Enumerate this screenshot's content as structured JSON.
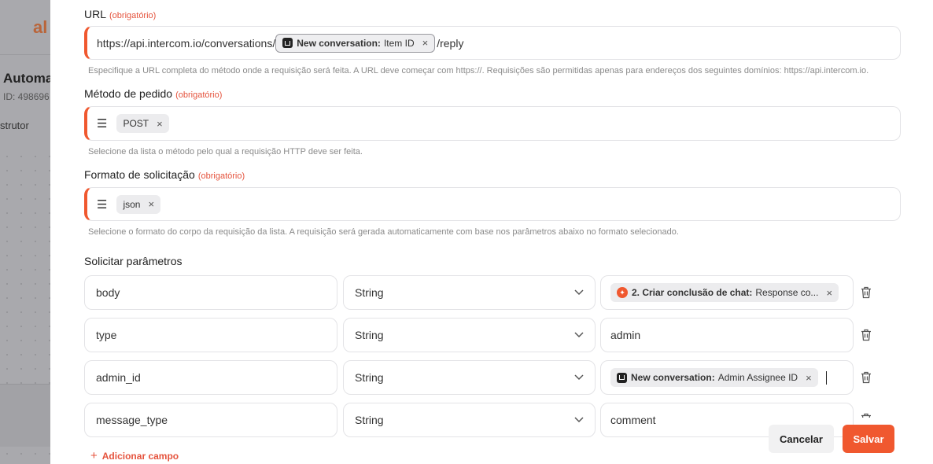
{
  "background": {
    "logo": "al",
    "title": "Automa",
    "id_text": "ID: 498696",
    "tab": "strutor"
  },
  "url_field": {
    "label": "URL",
    "required": "(obrigatório)",
    "prefix": "https://api.intercom.io/conversations/",
    "chip_bold": "New conversation:",
    "chip_text": "Item ID",
    "suffix": "/reply",
    "hint": "Especifique a URL completa do método onde a requisição será feita. A URL deve começar com https://. Requisições são permitidas apenas para endereços dos seguintes domínios: https://api.intercom.io."
  },
  "method_field": {
    "label": "Método de pedido",
    "required": "(obrigatório)",
    "value": "POST",
    "hint": "Selecione da lista o método pelo qual a requisição HTTP deve ser feita."
  },
  "format_field": {
    "label": "Formato de solicitação",
    "required": "(obrigatório)",
    "value": "json",
    "hint": "Selecione o formato do corpo da requisição da lista. A requisição será gerada automaticamente com base nos parâmetros abaixo no formato selecionado."
  },
  "params": {
    "title": "Solicitar parâmetros",
    "rows": [
      {
        "name": "body",
        "type": "String",
        "value_chip_bold": "2. Criar conclusão de chat:",
        "value_chip_text": "Response co..."
      },
      {
        "name": "type",
        "type": "String",
        "value": "admin"
      },
      {
        "name": "admin_id",
        "type": "String",
        "value_chip_bold": "New conversation:",
        "value_chip_text": "Admin Assignee ID"
      },
      {
        "name": "message_type",
        "type": "String",
        "value": "comment"
      }
    ],
    "add_field": "Adicionar campo"
  },
  "buttons": {
    "cancel": "Cancelar",
    "save": "Salvar"
  },
  "colors": {
    "accent": "#f0582f",
    "required": "#e5533d"
  },
  "icons": {
    "close": "×",
    "list": "☰",
    "chevron": "chevron-down",
    "trash": "trash",
    "plus": "+"
  }
}
